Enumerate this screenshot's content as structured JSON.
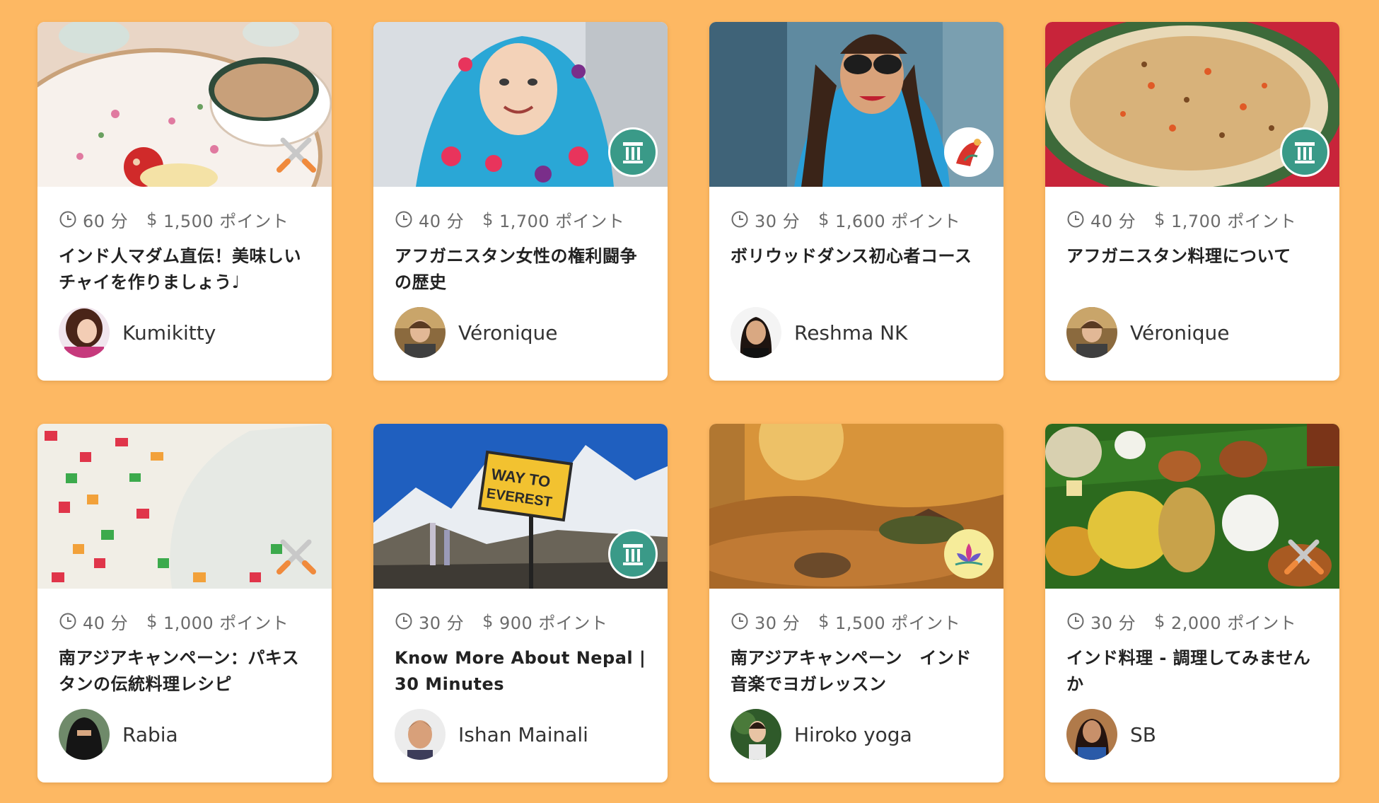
{
  "lessons": [
    {
      "duration": "60 分",
      "points": "1,500 ポイント",
      "title": "インド人マダム直伝！美味しいチャイを作りましょう♩",
      "teacher": "Kumikitty",
      "category_icon": "utensils-icon"
    },
    {
      "duration": "40 分",
      "points": "1,700 ポイント",
      "title": "アフガニスタン女性の権利闘争の歴史",
      "teacher": "Véronique",
      "category_icon": "pillar-icon"
    },
    {
      "duration": "30 分",
      "points": "1,600 ポイント",
      "title": "ボリウッドダンス初心者コース",
      "teacher": "Reshma NK",
      "category_icon": "dance-icon"
    },
    {
      "duration": "40 分",
      "points": "1,700 ポイント",
      "title": "アフガニスタン料理について",
      "teacher": "Véronique",
      "category_icon": "pillar-icon"
    },
    {
      "duration": "40 分",
      "points": "1,000 ポイント",
      "title": "南アジアキャンペーン：パキスタンの伝統料理レシピ",
      "teacher": "Rabia",
      "category_icon": "utensils-icon"
    },
    {
      "duration": "30 分",
      "points": "900 ポイント",
      "title": "Know More About Nepal | 30 Minutes",
      "teacher": "Ishan Mainali",
      "category_icon": "pillar-icon"
    },
    {
      "duration": "30 分",
      "points": "1,500 ポイント",
      "title": "南アジアキャンペーン　インド音楽でヨガレッスン",
      "teacher": "Hiroko yoga",
      "category_icon": "lotus-icon"
    },
    {
      "duration": "30 分",
      "points": "2,000 ポイント",
      "title": "インド料理 - 調理してみませんか",
      "teacher": "SB",
      "category_icon": "utensils-icon"
    }
  ],
  "currency_symbol": "$",
  "colors": {
    "background": "#fdb863",
    "card": "#ffffff",
    "meta_text": "#6b6b6b",
    "title_text": "#222222",
    "pillar_badge": "#3a9a88"
  }
}
